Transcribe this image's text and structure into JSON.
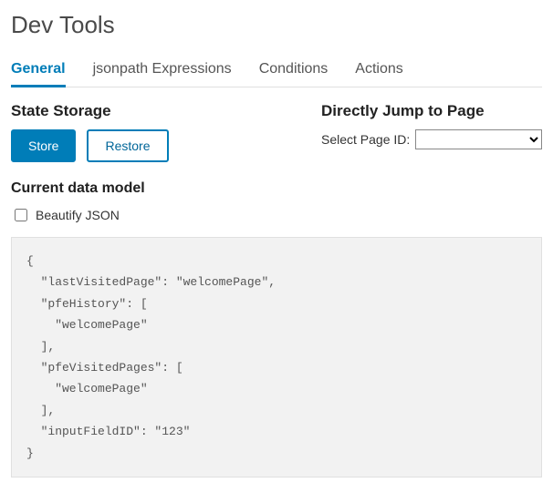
{
  "page_title": "Dev Tools",
  "tabs": [
    {
      "label": "General",
      "active": true
    },
    {
      "label": "jsonpath Expressions",
      "active": false
    },
    {
      "label": "Conditions",
      "active": false
    },
    {
      "label": "Actions",
      "active": false
    }
  ],
  "state_storage": {
    "heading": "State Storage",
    "store_label": "Store",
    "restore_label": "Restore"
  },
  "jump": {
    "heading": "Directly Jump to Page",
    "label": "Select Page ID:",
    "selected": ""
  },
  "data_model": {
    "heading": "Current data model",
    "beautify_label": "Beautify JSON",
    "beautify_checked": false,
    "json_text": "{\n  \"lastVisitedPage\": \"welcomePage\",\n  \"pfeHistory\": [\n    \"welcomePage\"\n  ],\n  \"pfeVisitedPages\": [\n    \"welcomePage\"\n  ],\n  \"inputFieldID\": \"123\"\n}"
  }
}
